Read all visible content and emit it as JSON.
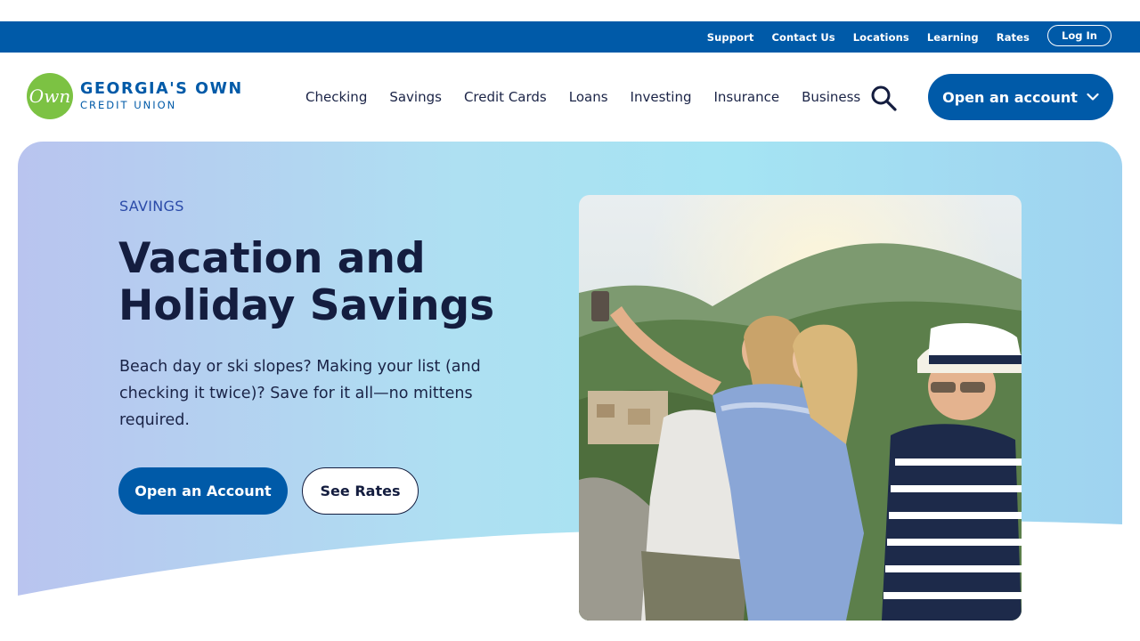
{
  "utility": {
    "links": [
      "Support",
      "Contact Us",
      "Locations",
      "Learning",
      "Rates"
    ],
    "login_label": "Log In"
  },
  "brand": {
    "mark": "Own",
    "name": "GEORGIA'S OWN",
    "subname": "CREDIT UNION"
  },
  "nav": {
    "items": [
      "Checking",
      "Savings",
      "Credit Cards",
      "Loans",
      "Investing",
      "Insurance",
      "Business"
    ],
    "search_icon": "search-icon",
    "open_account_label": "Open an account"
  },
  "hero": {
    "eyebrow": "SAVINGS",
    "title": "Vacation and Holiday Savings",
    "body": "Beach day or ski slopes? Making your list (and checking it twice)? Save for it all—no mittens required.",
    "primary_cta": "Open an Account",
    "secondary_cta": "See Rates",
    "photo": "photo of three women taking a selfie on a hillside"
  },
  "colors": {
    "brand_blue": "#005aa8",
    "brand_green": "#7cc243",
    "heading_navy": "#141d3f"
  }
}
